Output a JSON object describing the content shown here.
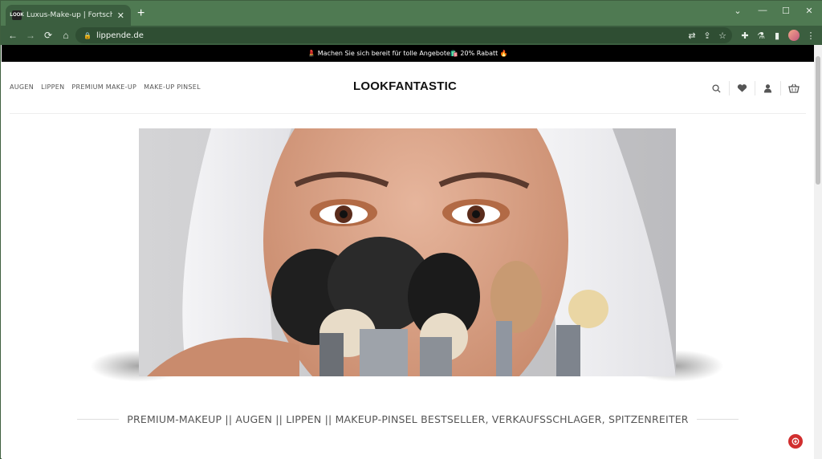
{
  "browser": {
    "tab_title": "Luxus-Make-up | Fortschrittliche",
    "favicon_text": "LOOK",
    "url": "lippende.de",
    "colors": {
      "frame": "#4f7a52",
      "toolbar": "#3b5e3f",
      "omnibox": "#2f4e33"
    }
  },
  "promo_text": "💄 Machen Sie sich bereit für tolle Angebote🛍️ 20% Rabatt 🔥",
  "nav": {
    "items": [
      "AUGEN",
      "LIPPEN",
      "PREMIUM MAKE-UP",
      "MAKE-UP PINSEL"
    ]
  },
  "logo": "LOOKFANTASTIC",
  "header_icons": [
    "search-icon",
    "heart-icon",
    "user-icon",
    "basket-icon"
  ],
  "section_title": "PREMIUM-MAKEUP || AUGEN || LIPPEN || MAKEUP-PINSEL BESTSELLER, VERKAUFSSCHLAGER, SPITZENREITER",
  "accent_color": "#d12e2e"
}
